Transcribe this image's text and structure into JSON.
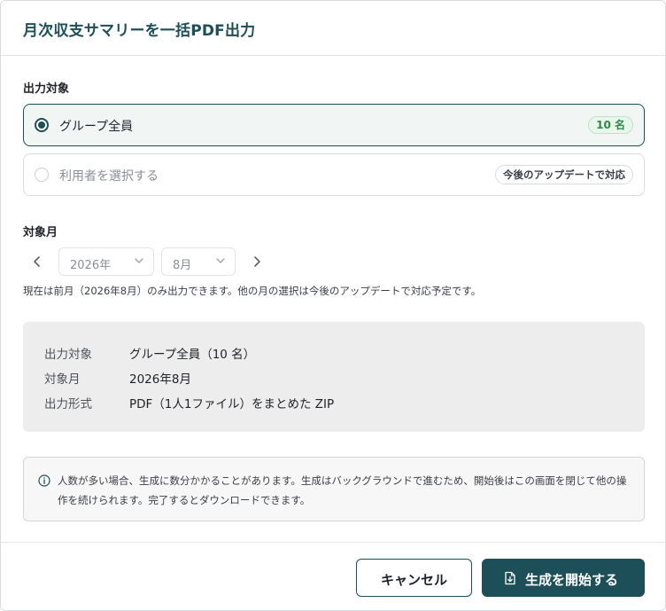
{
  "dialog": {
    "title": "月次収支サマリーを一括PDF出力"
  },
  "target": {
    "label": "出力対象",
    "options": [
      {
        "label": "グループ全員",
        "badge": "10 名",
        "selected": true
      },
      {
        "label": "利用者を選択する",
        "badge": "今後のアップデートで対応",
        "selected": false
      }
    ]
  },
  "month": {
    "label": "対象月",
    "year_value": "2026年",
    "month_value": "8月",
    "note": "現在は前月（2026年8月）のみ出力できます。他の月の選択は今後のアップデートで対応予定です。"
  },
  "summary": {
    "rows": [
      {
        "key": "出力対象",
        "value": "グループ全員（10 名）"
      },
      {
        "key": "対象月",
        "value": "2026年8月"
      },
      {
        "key": "出力形式",
        "value": "PDF（1人1ファイル）をまとめた ZIP"
      }
    ]
  },
  "info": {
    "icon": "info-icon",
    "text": "人数が多い場合、生成に数分かかることがあります。生成はバックグラウンドで進むため、開始後はこの画面を閉じて他の操作を続けられます。完了するとダウンロードできます。"
  },
  "footer": {
    "cancel_label": "キャンセル",
    "start_label": "生成を開始する",
    "start_icon": "file-download-icon"
  },
  "colors": {
    "accent": "#1c4f57",
    "badge_green": "#2f8a47"
  }
}
